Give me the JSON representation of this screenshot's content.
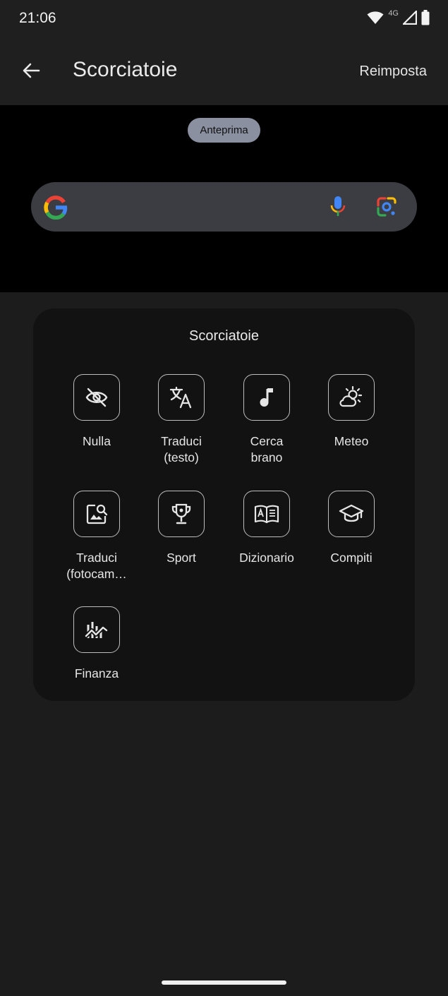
{
  "status_bar": {
    "time": "21:06",
    "network": "4G",
    "icons": [
      "wifi-icon",
      "cell-signal-icon",
      "battery-icon"
    ]
  },
  "app_bar": {
    "title": "Scorciatoie",
    "reset_label": "Reimposta",
    "back_icon": "arrow-back-icon"
  },
  "preview": {
    "chip_label": "Anteprima",
    "search_icons": [
      "google-g-icon",
      "microphone-icon",
      "lens-icon"
    ]
  },
  "sheet": {
    "title": "Scorciatoie",
    "items": [
      {
        "label": "Nulla",
        "icon": "eye-off-icon"
      },
      {
        "label": "Traduci\n(testo)",
        "icon": "translate-icon"
      },
      {
        "label": "Cerca\nbrano",
        "icon": "music-note-icon"
      },
      {
        "label": "Meteo",
        "icon": "weather-icon"
      },
      {
        "label": "Traduci\n(fotocam…",
        "icon": "image-search-icon"
      },
      {
        "label": "Sport",
        "icon": "trophy-icon"
      },
      {
        "label": "Dizionario",
        "icon": "dictionary-icon"
      },
      {
        "label": "Compiti",
        "icon": "school-icon"
      },
      {
        "label": "Finanza",
        "icon": "finance-chart-icon"
      }
    ]
  },
  "colors": {
    "background": "#1c1c1c",
    "app_bar": "#1f1f1f",
    "sheet": "#121212",
    "chip": "#8a90a0",
    "search_bar": "#3b3d42"
  }
}
